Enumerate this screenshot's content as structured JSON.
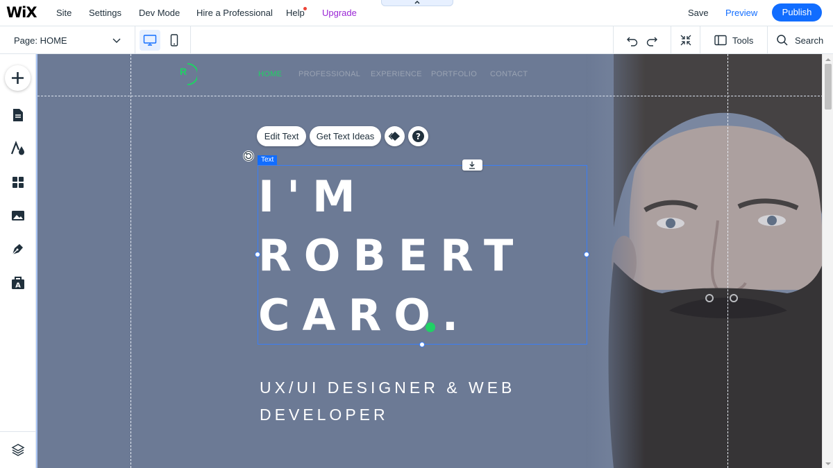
{
  "topbar": {
    "logo": "WiX",
    "menu": [
      "Site",
      "Settings",
      "Dev Mode",
      "Hire a Professional",
      "Help",
      "Upgrade"
    ],
    "save": "Save",
    "preview": "Preview",
    "publish": "Publish"
  },
  "subbar": {
    "page_label": "Page: HOME",
    "tools": "Tools",
    "search": "Search"
  },
  "sidebar": {
    "items": [
      "add-icon",
      "pages-icon",
      "design-icon",
      "apps-icon",
      "media-icon",
      "blog-icon",
      "business-icon",
      "layers-icon"
    ]
  },
  "site": {
    "logo_letter": "R",
    "nav": [
      "HOME",
      "PROFESSIONAL",
      "EXPERIENCE",
      "PORTFOLIO",
      "CONTACT"
    ],
    "headline": [
      "I'M",
      "ROBERT",
      "CARO."
    ],
    "subtitle": [
      "UX/UI DESIGNER & WEB",
      "DEVELOPER"
    ],
    "accent_color": "#20d165"
  },
  "editor": {
    "edit_text": "Edit Text",
    "get_text_ideas": "Get Text Ideas",
    "selection_tag": "Text"
  },
  "colors": {
    "primary": "#116dff",
    "upgrade": "#9a27d5",
    "canvas_bg": "#6c7a95"
  }
}
